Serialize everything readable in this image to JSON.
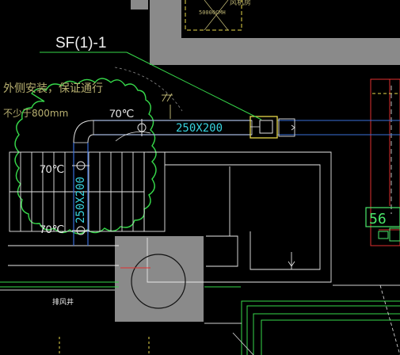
{
  "drawing": {
    "tag_label": "SF(1)-1",
    "note_lines": [
      "外侧安装，保证通行",
      "不少于800mm"
    ],
    "temp_label_top": "70℃",
    "temp_label_mid": "70℃",
    "temp_label_low": "70℃",
    "duct_size_horizontal": "250X200",
    "duct_size_vertical": "250X200",
    "room_tag": "56",
    "top_small_label": "50000CMH",
    "top_room_label": "风机房",
    "bottom_label": "排风井"
  },
  "colors": {
    "background": "#000000",
    "wall_fill": "#8a8a8a",
    "duct": "#d8d8d8",
    "duct_outline": "#3a6fd8",
    "leader_green": "#36d84a",
    "cloud_green": "#36d84a",
    "dim_cyan": "#38d4e0",
    "red_outline": "#e03030",
    "yellow": "#e8d84a",
    "stair_white": "#e8e8e8"
  }
}
